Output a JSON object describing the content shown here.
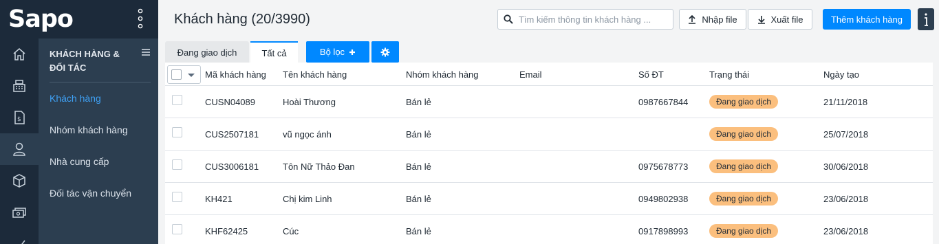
{
  "brand": {
    "logo": "Sapo"
  },
  "rail": {
    "icons": [
      "home-icon",
      "cashier-icon",
      "order-icon",
      "customer-icon",
      "product-icon",
      "cashbook-icon",
      "report-icon"
    ]
  },
  "subnav": {
    "title": "KHÁCH HÀNG & ĐỐI TÁC",
    "items": [
      "Khách hàng",
      "Nhóm khách hàng",
      "Nhà cung cấp",
      "Đối tác vận chuyển"
    ]
  },
  "header": {
    "title": "Khách hàng (20/3990)",
    "search_placeholder": "Tìm kiếm thông tin khách hàng ...",
    "import_label": "Nhập file",
    "export_label": "Xuất file",
    "add_label": "Thêm khách hàng"
  },
  "tabs": [
    "Đang giao dịch",
    "Tất cả"
  ],
  "filter_label": "Bộ lọc",
  "colors": {
    "primary": "#0088ff",
    "badge": "#fbbf7e",
    "sidebar": "#2c3e50",
    "rail": "#1c2a3a"
  },
  "table": {
    "columns": [
      "Mã khách hàng",
      "Tên khách hàng",
      "Nhóm khách hàng",
      "Email",
      "Số ĐT",
      "Trạng thái",
      "Ngày tạo"
    ],
    "rows": [
      {
        "code": "CUSN04089",
        "name": "Hoài Thương",
        "group": "Bán lẻ",
        "email": "",
        "phone": "0987667844",
        "status": "Đang giao dịch",
        "date": "21/11/2018"
      },
      {
        "code": "CUS2507181",
        "name": "vũ ngọc ánh",
        "group": "Bán lẻ",
        "email": "",
        "phone": "",
        "status": "Đang giao dịch",
        "date": "25/07/2018"
      },
      {
        "code": "CUS3006181",
        "name": "Tôn Nữ Thảo Đan",
        "group": "Bán lẻ",
        "email": "",
        "phone": "0975678773",
        "status": "Đang giao dịch",
        "date": "30/06/2018"
      },
      {
        "code": "KH421",
        "name": "Chị kim Linh",
        "group": "Bán lẻ",
        "email": "",
        "phone": "0949802938",
        "status": "Đang giao dịch",
        "date": "23/06/2018"
      },
      {
        "code": "KHF62425",
        "name": "Cúc",
        "group": "Bán lẻ",
        "email": "",
        "phone": "0917898993",
        "status": "Đang giao dịch",
        "date": "23/06/2018"
      }
    ]
  }
}
